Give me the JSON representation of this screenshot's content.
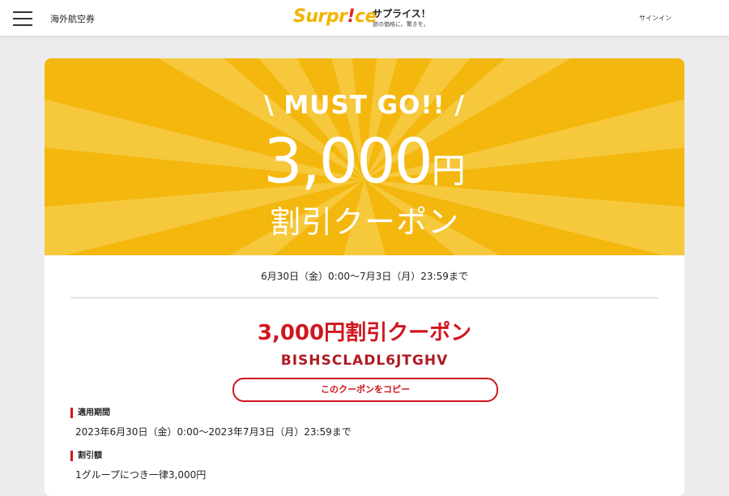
{
  "header": {
    "nav_link": "海外航空券",
    "logo_text_pre": "Surpr",
    "logo_text_bang": "!",
    "logo_text_post": "ce",
    "brand_name": "サプライス！",
    "brand_tagline": "旅の価格に、驚きを。",
    "signin": "サインイン"
  },
  "banner": {
    "must_go": "\\ MUST GO!! /",
    "amount": "3,000",
    "unit": "円",
    "coupon_label": "割引クーポン"
  },
  "coupon": {
    "period_short": "6月30日（金）0:00〜7月3日（月）23:59まで",
    "title": "3,000円割引クーポン",
    "code": "BISHSCLADL6JTGHV",
    "copy_button": "このクーポンをコピー",
    "sections": [
      {
        "label": "適用期間",
        "value": "2023年6月30日（金）0:00〜2023年7月3日（月）23:59まで"
      },
      {
        "label": "割引額",
        "value": "1グループにつき一律3,000円"
      }
    ]
  },
  "colors": {
    "brand_yellow": "#f3b70e",
    "accent_red": "#d0161e",
    "page_bg": "#ececec"
  }
}
